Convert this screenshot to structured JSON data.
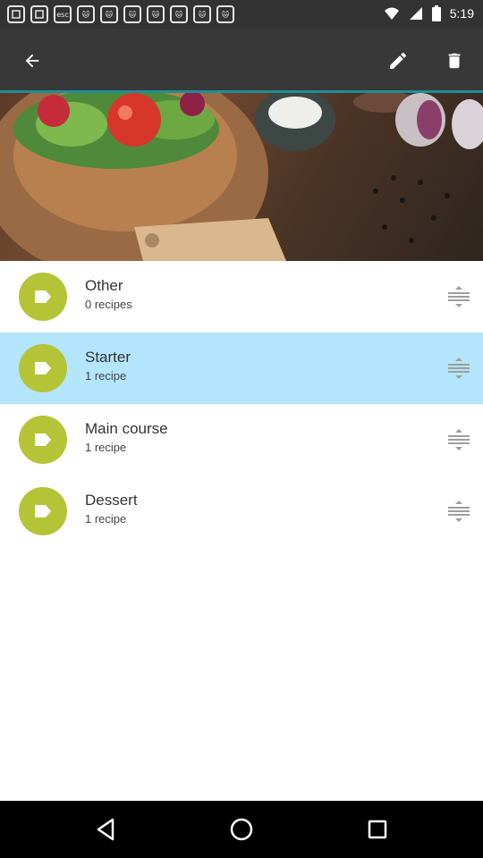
{
  "status_bar": {
    "time": "5:19",
    "notification_icons": [
      "notification-icon",
      "notification-icon",
      "esc-app-icon",
      "cat-icon",
      "cat-icon",
      "cat-icon",
      "cat-icon",
      "cat-icon",
      "cat-icon",
      "cat-icon"
    ],
    "esc_label": "esc"
  },
  "toolbar": {
    "back_icon": "arrow-back-icon",
    "edit_icon": "pencil-icon",
    "delete_icon": "trash-icon"
  },
  "categories": [
    {
      "title": "Other",
      "subtitle": "0 recipes",
      "selected": false
    },
    {
      "title": "Starter",
      "subtitle": "1 recipe",
      "selected": true
    },
    {
      "title": "Main course",
      "subtitle": "1 recipe",
      "selected": false
    },
    {
      "title": "Dessert",
      "subtitle": "1 recipe",
      "selected": false
    }
  ],
  "colors": {
    "toolbar": "#383838",
    "accent_line": "#1e8f94",
    "category_icon_bg": "#b5c337",
    "selected_row": "#b3e5fc"
  },
  "nav_bar": {
    "back_icon": "nav-back-icon",
    "home_icon": "nav-home-icon",
    "recents_icon": "nav-recents-icon"
  }
}
